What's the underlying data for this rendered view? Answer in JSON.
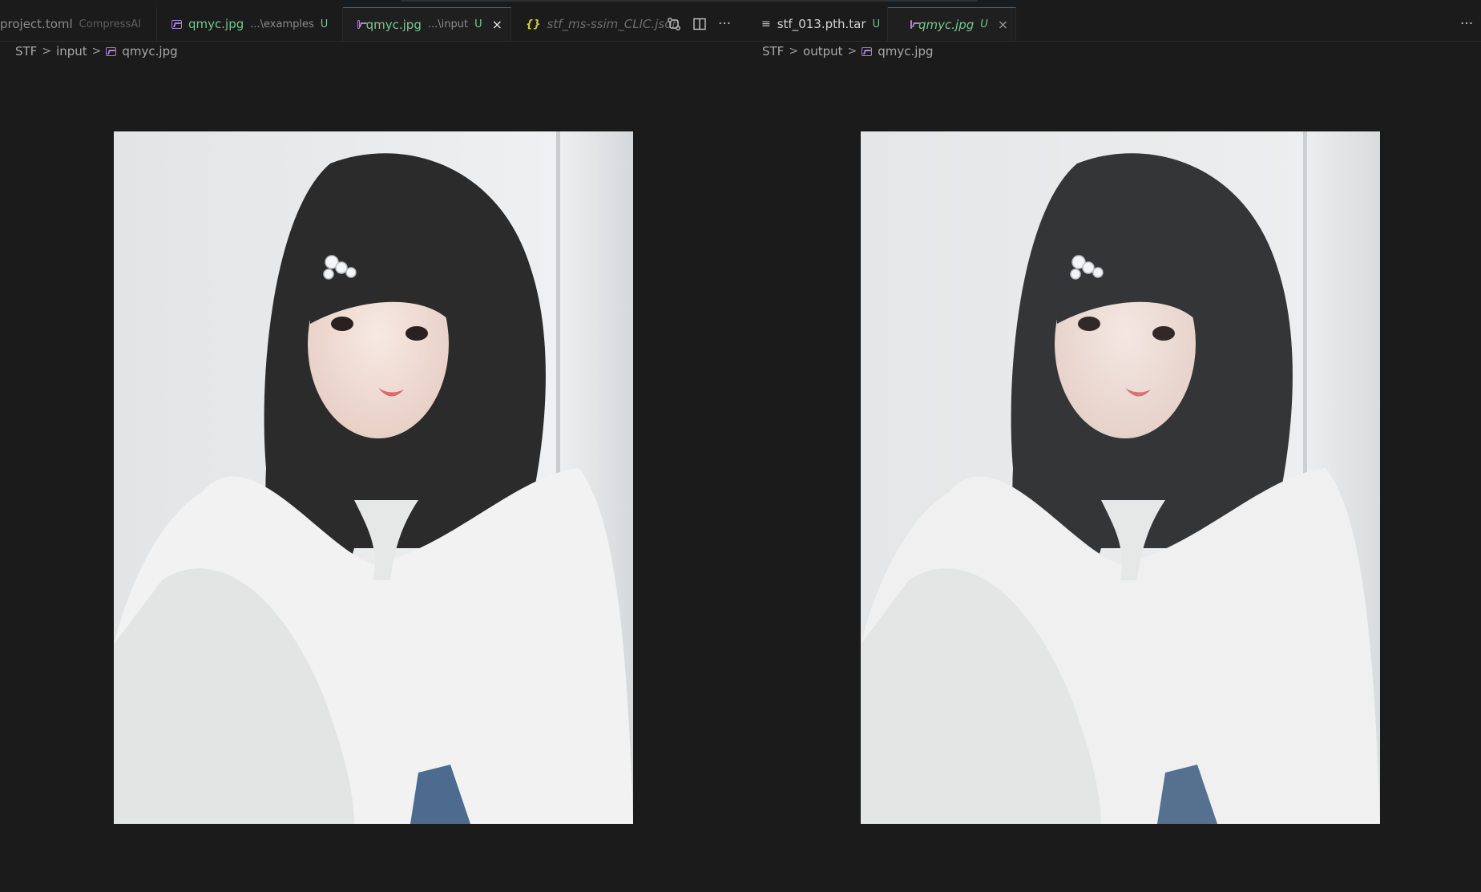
{
  "tabs": [
    {
      "label": "project.toml",
      "description": "CompressAI",
      "modified": ""
    },
    {
      "label": "qmyc.jpg",
      "description": "...\\examples",
      "modified": "U"
    },
    {
      "label": "qmyc.jpg",
      "description": "...\\input",
      "modified": "U",
      "close": "×"
    },
    {
      "label": "stf_ms-ssim_CLIC.json"
    },
    {
      "label": "stf_013.pth.tar",
      "modified": "U"
    },
    {
      "label": "qmyc.jpg",
      "modified": "U",
      "close": "×"
    }
  ],
  "toolbar": {
    "compare_icon": "git-compare-icon",
    "split_icon": "split-editor-icon",
    "more_label": "···",
    "right_more_label": "···"
  },
  "left_breadcrumb": {
    "root": "STF",
    "folder": "input",
    "file": "qmyc.jpg",
    "sep": ">"
  },
  "right_breadcrumb": {
    "root": "STF",
    "folder": "output",
    "file": "qmyc.jpg",
    "sep": ">"
  },
  "colors": {
    "accent": "#0078d4",
    "modified": "#73c991",
    "image_icon": "#b180d7",
    "json_icon": "#cbcb41"
  }
}
